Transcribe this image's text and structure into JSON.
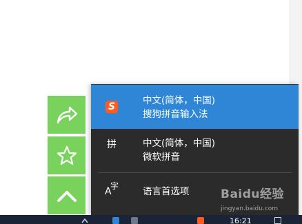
{
  "side_buttons": [
    {
      "name": "share",
      "icon": "share-icon"
    },
    {
      "name": "favorite",
      "icon": "star-icon"
    },
    {
      "name": "back-to-top",
      "icon": "chevron-up-icon"
    }
  ],
  "ime_menu": {
    "items": [
      {
        "icon": "sogou-icon",
        "icon_glyph": "S",
        "line1": "中文(简体，中国)",
        "line2": "搜狗拼音输入法",
        "active": true
      },
      {
        "icon": "microsoft-pinyin-icon",
        "icon_glyph": "拼",
        "line1": "中文(简体，中国)",
        "line2": "微软拼音",
        "active": false
      }
    ],
    "preferences": {
      "icon": "language-icon",
      "icon_a": "A",
      "icon_zi": "字",
      "label": "语言首选项"
    }
  },
  "taskbar": {
    "time": "16:21"
  },
  "watermark": {
    "brand": "Baidu经验",
    "url": "jingyan.baidu.com"
  },
  "colors": {
    "green_button": "#79d25b",
    "menu_bg": "#2b2b2b",
    "menu_active": "#2f86d6",
    "sogou_orange": "#ff5a1f",
    "taskbar": "#1a2436"
  }
}
